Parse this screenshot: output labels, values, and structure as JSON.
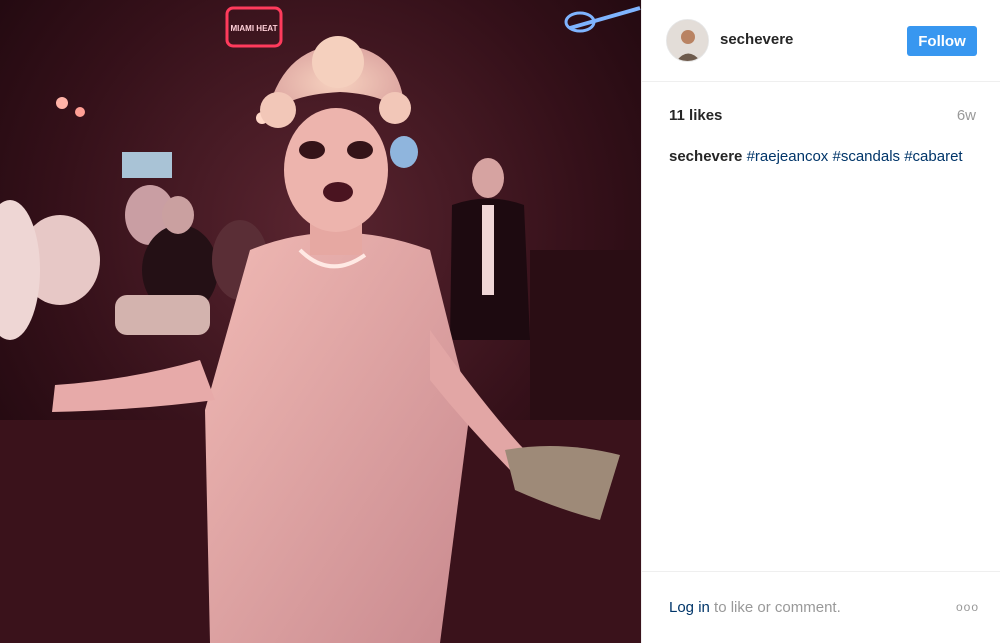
{
  "post": {
    "username": "sechevere",
    "follow_label": "Follow",
    "likes": "11 likes",
    "age": "6w",
    "caption_user": "sechevere",
    "hashtags": [
      "#raejeancox",
      "#scandals",
      "#cabaret"
    ]
  },
  "photo": {
    "neon_sign": "MIAMI HEAT"
  },
  "footer": {
    "login_link": "Log in",
    "login_rest": " to like or comment.",
    "more_icon": "ooo"
  },
  "colors": {
    "follow_button": "#3897f0",
    "hashtag": "#003569",
    "muted": "#999999"
  },
  "icons": {
    "more": "more-options-icon"
  }
}
